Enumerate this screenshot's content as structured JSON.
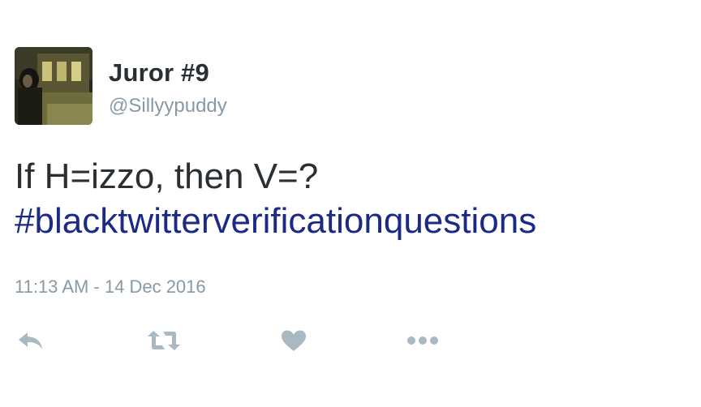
{
  "tweet": {
    "display_name": "Juror #9",
    "handle": "@Sillyypuddy",
    "text_line1": "If H=izzo, then V=?",
    "hashtag": "#blacktwitterverificationquestions",
    "timestamp": "11:13 AM - 14 Dec 2016"
  },
  "actions": {
    "reply_icon": "reply-icon",
    "retweet_icon": "retweet-icon",
    "like_icon": "heart-icon",
    "more_icon": "more-dots-icon"
  },
  "colors": {
    "text": "#292f33",
    "muted": "#8899a6",
    "hashtag": "#1b2a84",
    "icon": "#aab8c2"
  }
}
